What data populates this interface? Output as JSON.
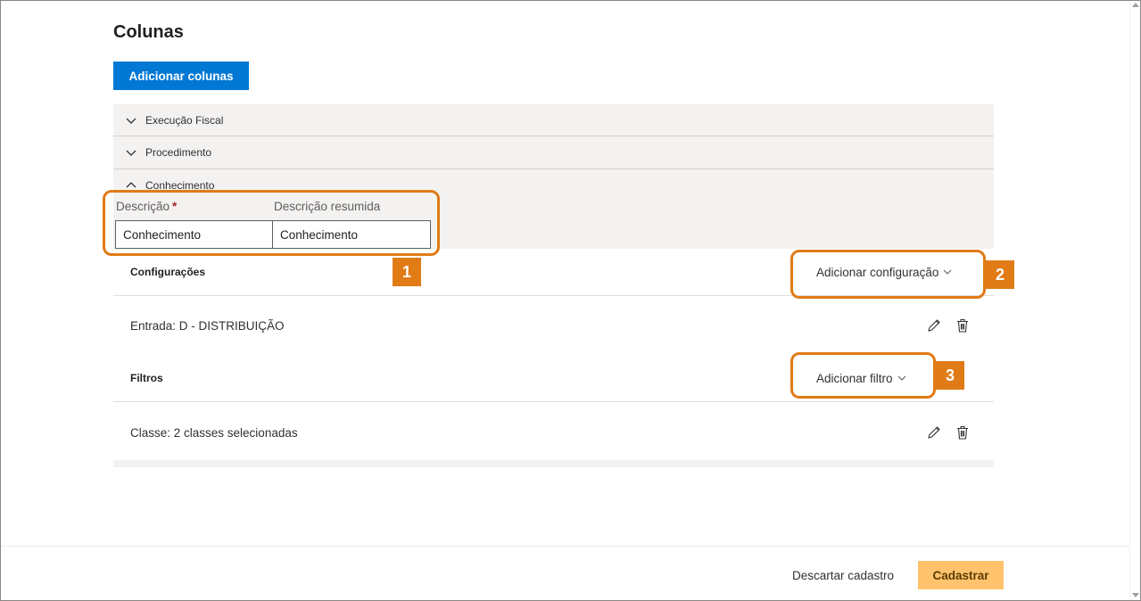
{
  "page": {
    "title": "Colunas",
    "add_columns_label": "Adicionar colunas"
  },
  "accordion": {
    "items": [
      {
        "label": "Execução Fiscal",
        "expanded": false,
        "icon": "chevron-down-icon"
      },
      {
        "label": "Procedimento",
        "expanded": false,
        "icon": "chevron-down-icon"
      },
      {
        "label": "Conhecimento",
        "expanded": true,
        "icon": "chevron-up-icon"
      }
    ]
  },
  "form": {
    "description_label": "Descrição",
    "required_marker": "*",
    "description_value": "Conhecimento",
    "short_description_label": "Descrição resumida",
    "short_description_value": "Conhecimento"
  },
  "configurations": {
    "title": "Configurações",
    "add_label": "Adicionar configuração",
    "items": [
      {
        "text": "Entrada: D - DISTRIBUIÇÃO"
      }
    ]
  },
  "filters": {
    "title": "Filtros",
    "add_label": "Adicionar filtro",
    "items": [
      {
        "text": "Classe: 2 classes selecionadas"
      }
    ]
  },
  "callouts": [
    "1",
    "2",
    "3"
  ],
  "footer": {
    "discard_label": "Descartar cadastro",
    "submit_label": "Cadastrar"
  },
  "colors": {
    "primary": "#0078d4",
    "callout": "#e07b16",
    "submit": "#ffc36d"
  }
}
